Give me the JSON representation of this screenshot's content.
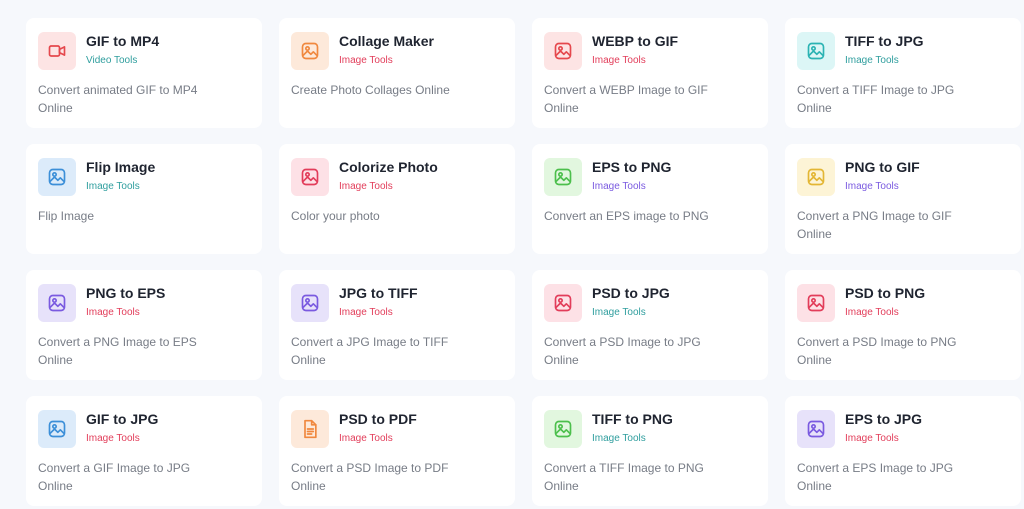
{
  "cards": [
    {
      "title": "GIF to MP4",
      "category": "Video Tools",
      "description": "Convert animated GIF to MP4 Online",
      "icon": "video-camera-icon",
      "icon_bg": "#fde4e4",
      "icon_color": "#e5484d",
      "category_color": "#2f9e9e"
    },
    {
      "title": "Collage Maker",
      "category": "Image Tools",
      "description": "Create Photo Collages Online",
      "icon": "image-icon",
      "icon_bg": "#fde9da",
      "icon_color": "#f0883e",
      "category_color": "#e23d5a"
    },
    {
      "title": "WEBP to GIF",
      "category": "Image Tools",
      "description": "Convert a WEBP Image to GIF Online",
      "icon": "image-icon",
      "icon_bg": "#fde4e4",
      "icon_color": "#e5484d",
      "category_color": "#e23d5a"
    },
    {
      "title": "TIFF to JPG",
      "category": "Image Tools",
      "description": "Convert a TIFF Image to JPG Online",
      "icon": "image-icon",
      "icon_bg": "#dcf6f6",
      "icon_color": "#2bb3b3",
      "category_color": "#2f9e9e"
    },
    {
      "title": "Flip Image",
      "category": "Image Tools",
      "description": "Flip Image",
      "icon": "image-icon",
      "icon_bg": "#dcebfa",
      "icon_color": "#3c8fd8",
      "category_color": "#2f9e9e"
    },
    {
      "title": "Colorize Photo",
      "category": "Image Tools",
      "description": "Color your photo",
      "icon": "image-icon",
      "icon_bg": "#fde1e6",
      "icon_color": "#e23d5a",
      "category_color": "#e23d5a"
    },
    {
      "title": "EPS to PNG",
      "category": "Image Tools",
      "description": "Convert an EPS image to PNG",
      "icon": "image-icon",
      "icon_bg": "#e2f7df",
      "icon_color": "#4cbf4c",
      "category_color": "#7a5ae0"
    },
    {
      "title": "PNG to GIF",
      "category": "Image Tools",
      "description": "Convert a PNG Image to GIF Online",
      "icon": "image-icon",
      "icon_bg": "#fdf4d6",
      "icon_color": "#e3b634",
      "category_color": "#7a5ae0"
    },
    {
      "title": "PNG to EPS",
      "category": "Image Tools",
      "description": "Convert a PNG Image to EPS Online",
      "icon": "image-icon",
      "icon_bg": "#e7e2fa",
      "icon_color": "#7a5ae0",
      "category_color": "#e23d5a"
    },
    {
      "title": "JPG to TIFF",
      "category": "Image Tools",
      "description": "Convert a JPG Image to TIFF Online",
      "icon": "image-icon",
      "icon_bg": "#e7e2fa",
      "icon_color": "#7a5ae0",
      "category_color": "#e23d5a"
    },
    {
      "title": "PSD to JPG",
      "category": "Image Tools",
      "description": "Convert a PSD Image to JPG Online",
      "icon": "image-icon",
      "icon_bg": "#fde1e6",
      "icon_color": "#e23d5a",
      "category_color": "#2f9e9e"
    },
    {
      "title": "PSD to PNG",
      "category": "Image Tools",
      "description": "Convert a PSD Image to PNG Online",
      "icon": "image-icon",
      "icon_bg": "#fde1e6",
      "icon_color": "#e23d5a",
      "category_color": "#e23d5a"
    },
    {
      "title": "GIF to JPG",
      "category": "Image Tools",
      "description": "Convert a GIF Image to JPG Online",
      "icon": "image-icon",
      "icon_bg": "#dcebfa",
      "icon_color": "#3c8fd8",
      "category_color": "#e23d5a"
    },
    {
      "title": "PSD to PDF",
      "category": "Image Tools",
      "description": "Convert a PSD Image to PDF Online",
      "icon": "document-icon",
      "icon_bg": "#fde9da",
      "icon_color": "#f0883e",
      "category_color": "#e23d5a"
    },
    {
      "title": "TIFF to PNG",
      "category": "Image Tools",
      "description": "Convert a TIFF Image to PNG Online",
      "icon": "image-icon",
      "icon_bg": "#e2f7df",
      "icon_color": "#4cbf4c",
      "category_color": "#2f9e9e"
    },
    {
      "title": "EPS to JPG",
      "category": "Image Tools",
      "description": "Convert a EPS Image to JPG Online",
      "icon": "image-icon",
      "icon_bg": "#e7e2fa",
      "icon_color": "#7a5ae0",
      "category_color": "#e23d5a"
    }
  ]
}
